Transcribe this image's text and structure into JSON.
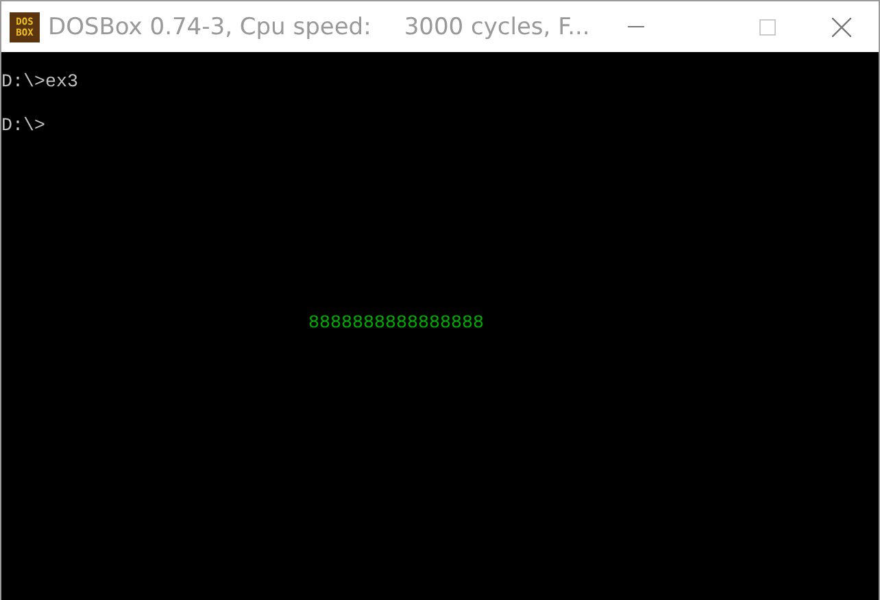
{
  "window": {
    "title_parts": [
      "DOSBox 0.74-3, Cpu speed:",
      "3000 cycles, F..."
    ],
    "icon_text": [
      "DOS",
      "BOX"
    ]
  },
  "console": {
    "lines": [
      {
        "text": "D:\\>ex3",
        "color": "#c0c0c0"
      },
      {
        "text": "D:\\>",
        "color": "#c0c0c0"
      },
      {
        "text": "8888888888888888",
        "color": "#00aa00"
      }
    ]
  }
}
